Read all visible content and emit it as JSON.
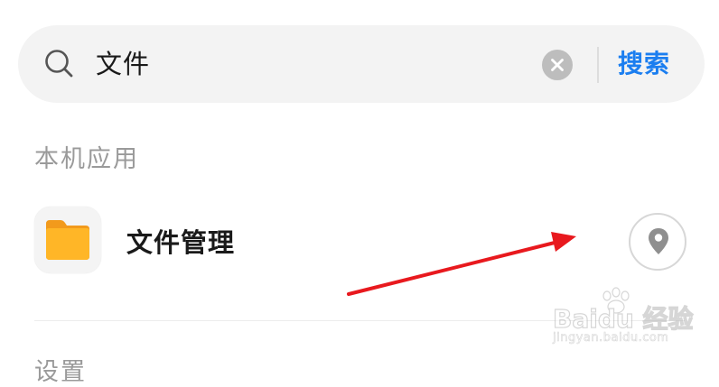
{
  "search": {
    "query": "文件",
    "search_label": "搜索",
    "search_icon": "search-icon",
    "clear_icon": "clear-icon"
  },
  "sections": {
    "local_apps": "本机应用",
    "settings": "设置"
  },
  "app_result": {
    "name": "文件管理",
    "icon": "folder-icon",
    "action_icon": "location-pin-icon"
  },
  "watermark": {
    "brand": "Baidu 经验",
    "url": "jingyan.baidu.com"
  },
  "colors": {
    "accent": "#1b7ef0",
    "search_bg": "#f3f3f3",
    "folder": "#ffb627",
    "arrow": "#e8191e"
  }
}
